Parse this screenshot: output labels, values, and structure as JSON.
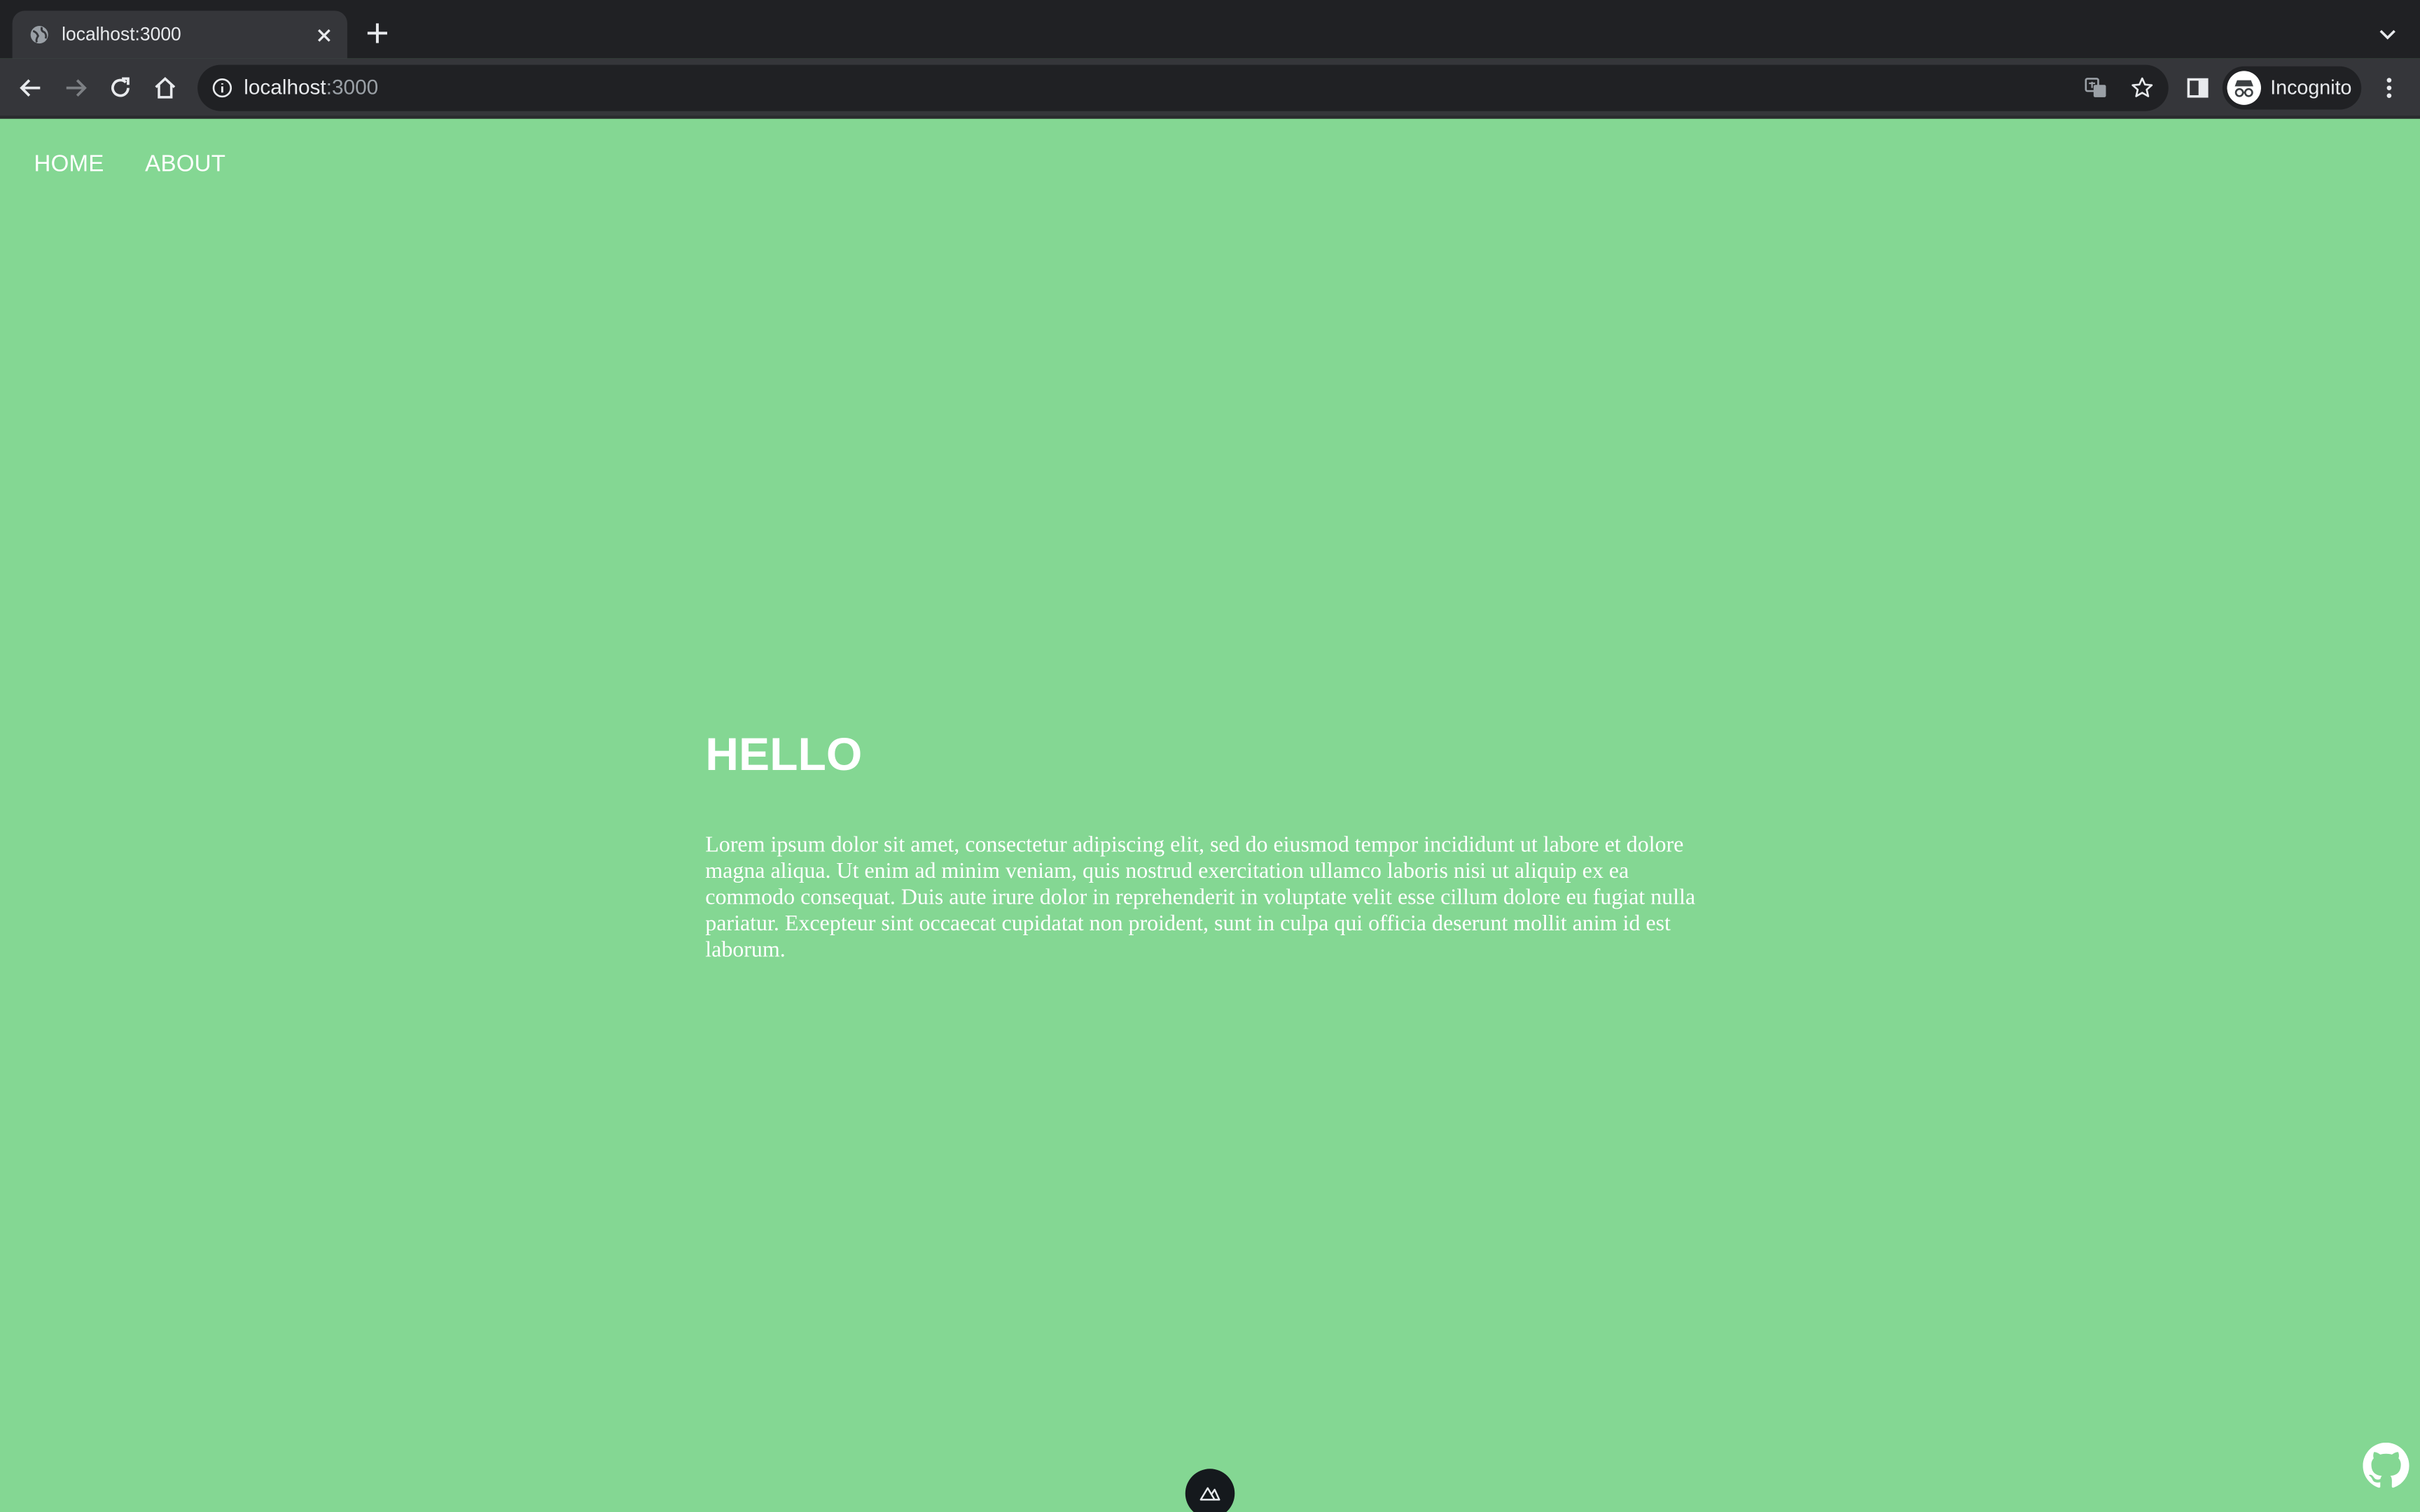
{
  "browser": {
    "tab_title": "localhost:3000",
    "url_host": "localhost",
    "url_port": ":3000",
    "profile_label": "Incognito"
  },
  "nav": {
    "items": [
      {
        "label": "HOME"
      },
      {
        "label": "ABOUT"
      }
    ]
  },
  "main": {
    "heading": "HELLO",
    "paragraph": "Lorem ipsum dolor sit amet, consectetur adipiscing elit, sed do eiusmod tempor incididunt ut labore et dolore magna aliqua. Ut enim ad minim veniam, quis nostrud exercitation ullamco laboris nisi ut aliquip ex ea commodo consequat. Duis aute irure dolor in reprehenderit in voluptate velit esse cillum dolore eu fugiat nulla pariatur. Excepteur sint occaecat cupidatat non proident, sunt in culpa qui officia deserunt mollit anim id est laborum."
  },
  "colors": {
    "page_background": "#84d793",
    "text": "#ffffff",
    "browser_frame": "#202124",
    "toolbar": "#35363a"
  },
  "icons": [
    "globe-icon",
    "close-icon",
    "plus-icon",
    "chevron-down-icon",
    "back-arrow-icon",
    "forward-arrow-icon",
    "reload-icon",
    "home-icon",
    "info-icon",
    "translate-icon",
    "star-icon",
    "side-panel-icon",
    "incognito-icon",
    "more-vert-icon",
    "nuxt-logo-icon",
    "github-icon"
  ]
}
